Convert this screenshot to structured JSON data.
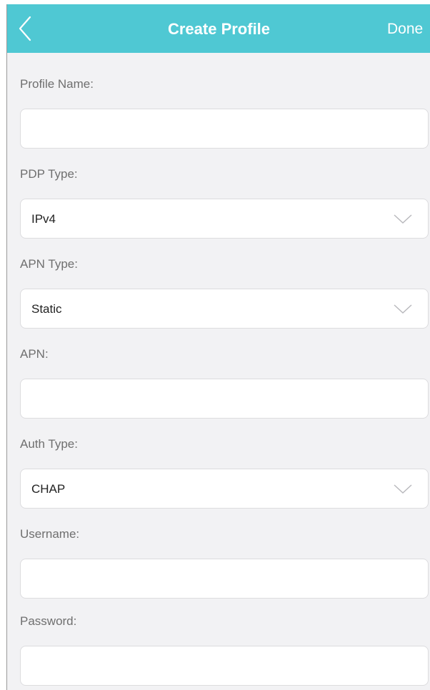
{
  "navbar": {
    "title": "Create Profile",
    "done_label": "Done"
  },
  "form": {
    "profile_name_label": "Profile Name:",
    "profile_name_value": "",
    "pdp_type_label": "PDP Type:",
    "pdp_type_value": "IPv4",
    "apn_type_label": "APN Type:",
    "apn_type_value": "Static",
    "apn_label": "APN:",
    "apn_value": "",
    "auth_type_label": "Auth Type:",
    "auth_type_value": "CHAP",
    "username_label": "Username:",
    "username_value": "",
    "password_label": "Password:",
    "password_value": ""
  },
  "icons": {
    "back": "chevron-left-icon",
    "dropdown": "chevron-down-icon"
  },
  "colors": {
    "navbar_background": "#4fc8d3",
    "page_background": "#f2f2f4",
    "field_background": "#ffffff",
    "label_text": "#6f6f6f",
    "value_text": "#222222"
  }
}
